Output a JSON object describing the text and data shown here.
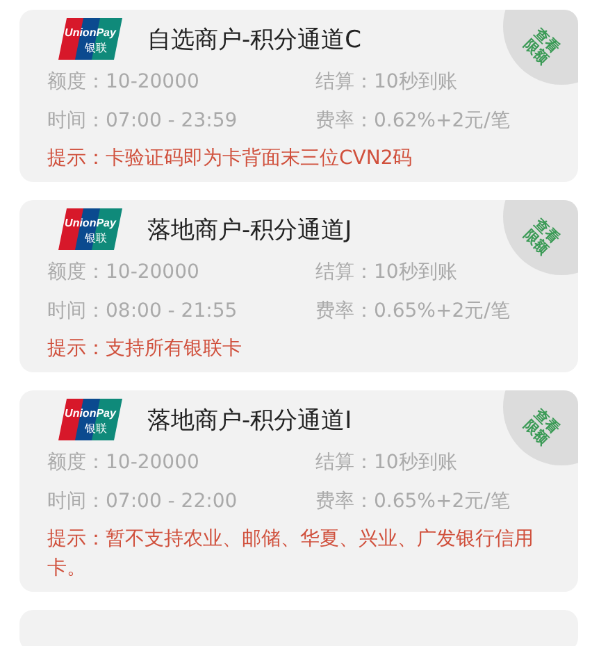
{
  "channels": [
    {
      "logo": {
        "brand": "UnionPay",
        "local": "银联"
      },
      "title": "自选商户-积分通道C",
      "badge": [
        "查看",
        "限额"
      ],
      "fields": [
        {
          "label": "额度：",
          "value": "10-20000"
        },
        {
          "label": "结算：",
          "value": "10秒到账"
        },
        {
          "label": "时间：",
          "value": "07:00 - 23:59"
        },
        {
          "label": "费率：",
          "value": "0.62%+2元/笔"
        }
      ],
      "tip": "提示：卡验证码即为卡背面末三位CVN2码"
    },
    {
      "logo": {
        "brand": "UnionPay",
        "local": "银联"
      },
      "title": "落地商户-积分通道J",
      "badge": [
        "查看",
        "限额"
      ],
      "fields": [
        {
          "label": "额度：",
          "value": "10-20000"
        },
        {
          "label": "结算：",
          "value": "10秒到账"
        },
        {
          "label": "时间：",
          "value": "08:00 - 21:55"
        },
        {
          "label": "费率：",
          "value": "0.65%+2元/笔"
        }
      ],
      "tip": "提示：支持所有银联卡"
    },
    {
      "logo": {
        "brand": "UnionPay",
        "local": "银联"
      },
      "title": "落地商户-积分通道I",
      "badge": [
        "查看",
        "限额"
      ],
      "fields": [
        {
          "label": "额度：",
          "value": "10-20000"
        },
        {
          "label": "结算：",
          "value": "10秒到账"
        },
        {
          "label": "时间：",
          "value": "07:00 - 22:00"
        },
        {
          "label": "费率：",
          "value": "0.65%+2元/笔"
        }
      ],
      "tip": "提示：暂不支持农业、邮储、华夏、兴业、广发银行信用卡。"
    }
  ]
}
